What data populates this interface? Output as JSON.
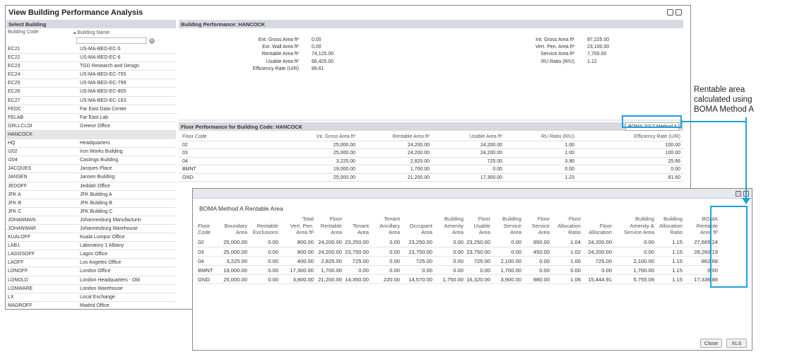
{
  "window": {
    "title": "View Building Performance Analysis"
  },
  "select_building": {
    "header": "Select Building",
    "col_code": "Building Code",
    "col_name": "Building Name",
    "rows": [
      [
        "EC21",
        "US-MA-BED-EC-5"
      ],
      [
        "EC22",
        "US-MA-BED-EC-6"
      ],
      [
        "EC23",
        "TGD Research and Design"
      ],
      [
        "EC24",
        "US-MA-BED-EC-755"
      ],
      [
        "EC25",
        "US-MA-BED-EC-799"
      ],
      [
        "EC26",
        "US-MA-BED-EC-805"
      ],
      [
        "EC27",
        "US-MA-BED-EC-163"
      ],
      [
        "FEDC",
        "Far East Data Center"
      ],
      [
        "FELAB",
        "Far East Lab"
      ],
      [
        "GRLLCLOI",
        "Greece Office"
      ],
      [
        "HANCOCK",
        ""
      ],
      [
        "HQ",
        "Headquarters"
      ],
      [
        "I202",
        "Iron Works Building"
      ],
      [
        "I204",
        "Castings Building"
      ],
      [
        "JACQUES",
        "Jacques Place"
      ],
      [
        "JANSEN",
        "Jansen Building"
      ],
      [
        "JEDOFF",
        "Jeddah Office"
      ],
      [
        "JFK A",
        "JFK Building A"
      ],
      [
        "JFK B",
        "JFK Building B"
      ],
      [
        "JFK C",
        "JFK Building C"
      ],
      [
        "JOHANMAN",
        "Johannesburg Manufacturin"
      ],
      [
        "JOHANWAR",
        "Johannesburg Warehouse"
      ],
      [
        "KUALOFF",
        "Kuala Lumpur Office"
      ],
      [
        "LAB1",
        "Laboratory 1 Albany"
      ],
      [
        "LAGOSOFF",
        "Lagos Office"
      ],
      [
        "LAOFF",
        "Los Angeles Office"
      ],
      [
        "LONOFF",
        "London Office"
      ],
      [
        "LONOLD",
        "London Headquarters - Old"
      ],
      [
        "LONWARE",
        "London Warehouse"
      ],
      [
        "LX",
        "Local Exchange"
      ],
      [
        "MADROFF",
        "Madrid Office"
      ]
    ]
  },
  "building_performance": {
    "header": "Building Performance: HANCOCK",
    "left": [
      [
        "Ext. Gross Area ft²",
        "0.00"
      ],
      [
        "Ext. Wall Area ft²",
        "0.00"
      ],
      [
        "Rentable Area ft²",
        "74,125.00"
      ],
      [
        "Usable Area ft²",
        "66,425.00"
      ],
      [
        "Efficiency Rate (U/R)",
        "89.61"
      ]
    ],
    "right": [
      [
        "Int. Gross Area ft²",
        "97,225.00"
      ],
      [
        "Vert. Pen. Area ft²",
        "23,100.00"
      ],
      [
        "Service Area ft²",
        "7,700.00"
      ],
      [
        "RU Ratio (R/U)",
        "1.12"
      ]
    ]
  },
  "floor_performance": {
    "header": "Floor Performance for Building Code: HANCOCK",
    "method_button": "BOMA 2017 Method A",
    "columns": [
      "Floor Code",
      "Int. Gross Area ft²",
      "Rentable Area ft²",
      "Usable Area ft²",
      "RU Ratio (R/U)",
      "Efficiency Rate (U/R)"
    ],
    "rows": [
      [
        "02",
        "25,000.00",
        "24,200.00",
        "24,200.00",
        "1.00",
        "100.00"
      ],
      [
        "03",
        "25,000.00",
        "24,200.00",
        "24,200.00",
        "1.00",
        "100.00"
      ],
      [
        "04",
        "3,225.00",
        "2,825.00",
        "725.00",
        "3.90",
        "25.66"
      ],
      [
        "BMNT",
        "19,000.00",
        "1,700.00",
        "0.00",
        "0.00",
        "0.00"
      ],
      [
        "GND",
        "25,000.00",
        "21,200.00",
        "17,300.00",
        "1.23",
        "81.60"
      ]
    ]
  },
  "boma_popup": {
    "title": "BOMA Method A Rentable Area",
    "columns": [
      [
        "Floor",
        "Code"
      ],
      [
        "Boundary",
        "Area"
      ],
      [
        "Rentable",
        "Exclusions"
      ],
      [
        "Total",
        "Vert. Pen.",
        "Area ft²"
      ],
      [
        "Floor",
        "Rentable",
        "Area"
      ],
      [
        "Tenant",
        "Area"
      ],
      [
        "Tenant",
        "Ancillary",
        "Area"
      ],
      [
        "Occupant",
        "Area"
      ],
      [
        "Building",
        "Amenity",
        "Area"
      ],
      [
        "Floor",
        "Usable",
        "Area"
      ],
      [
        "Building",
        "Service",
        "Area"
      ],
      [
        "Floor",
        "Service",
        "Area"
      ],
      [
        "Floor",
        "Allocation",
        "Ratio"
      ],
      [
        "Floor",
        "Allocation"
      ],
      [
        "Building",
        "Amenity &",
        "Service Area"
      ],
      [
        "Building",
        "Allocation",
        "Ratio"
      ],
      [
        "BOMA",
        "Rentable",
        "Area ft²"
      ]
    ],
    "rows": [
      [
        "02",
        "25,000.00",
        "0.00",
        "800.00",
        "24,200.00",
        "23,250.00",
        "0.00",
        "23,250.00",
        "0.00",
        "23,250.00",
        "0.00",
        "950.00",
        "1.04",
        "24,200.00",
        "0.00",
        "1.15",
        "27,665.24"
      ],
      [
        "03",
        "25,000.00",
        "0.00",
        "800.00",
        "24,200.00",
        "23,750.00",
        "0.00",
        "23,750.00",
        "0.00",
        "23,750.00",
        "0.00",
        "450.00",
        "1.02",
        "24,200.00",
        "0.00",
        "1.15",
        "28,260.19"
      ],
      [
        "04",
        "3,225.00",
        "0.00",
        "400.00",
        "2,825.00",
        "725.00",
        "0.00",
        "725.00",
        "0.00",
        "725.00",
        "2,100.00",
        "0.00",
        "1.00",
        "725.00",
        "2,100.00",
        "1.15",
        "862.68"
      ],
      [
        "BMNT",
        "19,000.00",
        "0.00",
        "17,300.00",
        "1,700.00",
        "0.00",
        "0.00",
        "0.00",
        "0.00",
        "0.00",
        "1,700.00",
        "0.00",
        "0.00",
        "0.00",
        "1,700.00",
        "1.15",
        "0.00"
      ],
      [
        "GND",
        "25,000.00",
        "0.00",
        "3,800.00",
        "21,200.00",
        "14,350.00",
        "220.00",
        "14,570.00",
        "1,750.00",
        "16,320.00",
        "3,900.00",
        "980.00",
        "1.06",
        "15,444.91",
        "5,755.09",
        "1.15",
        "17,336.88"
      ]
    ],
    "close_label": "Close",
    "xls_label": "XLS"
  },
  "annotation": {
    "line1": "Rentable area",
    "line2": "calculated using",
    "line3": "BOMA Method A"
  },
  "colors": {
    "header_bg": "#d6dae0",
    "highlight": "#1ea1db"
  }
}
